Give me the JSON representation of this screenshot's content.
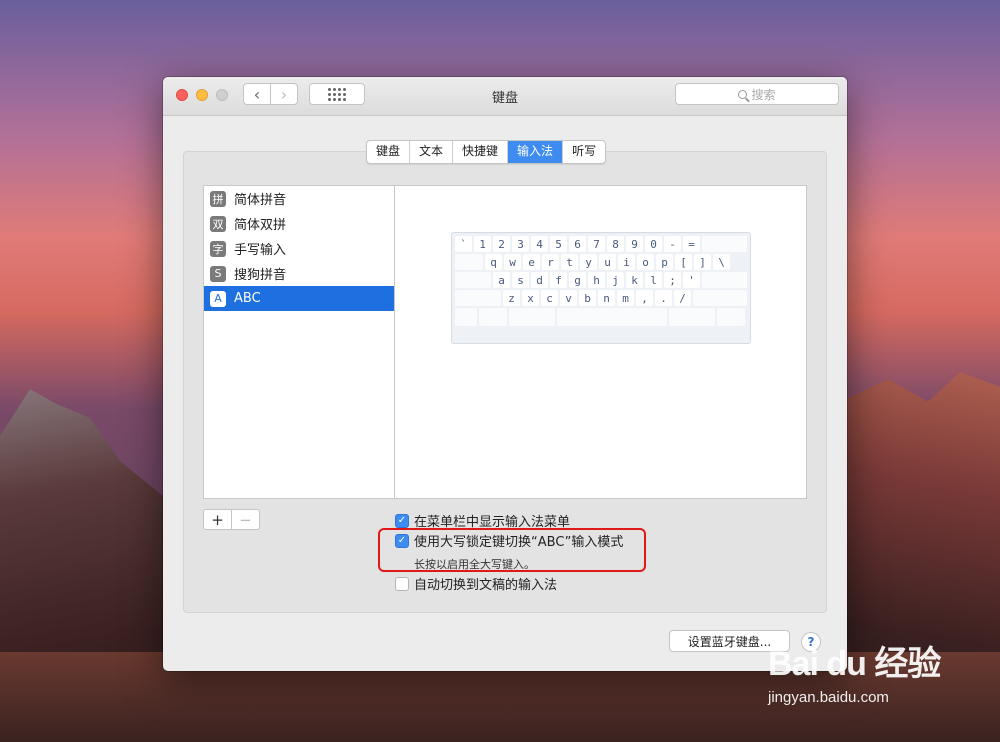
{
  "window": {
    "title": "键盘",
    "search_placeholder": "搜索"
  },
  "tabs": [
    {
      "label": "键盘",
      "active": false
    },
    {
      "label": "文本",
      "active": false
    },
    {
      "label": "快捷键",
      "active": false
    },
    {
      "label": "输入法",
      "active": true
    },
    {
      "label": "听写",
      "active": false
    }
  ],
  "input_sources": [
    {
      "icon_char": "拼",
      "icon": "pinyin-icon",
      "label": "简体拼音"
    },
    {
      "icon_char": "双",
      "icon": "shuangpin-icon",
      "label": "简体双拼"
    },
    {
      "icon_char": "字",
      "icon": "handwriting-icon",
      "label": "手写输入"
    },
    {
      "icon_char": "S",
      "icon": "sogou-icon",
      "label": "搜狗拼音"
    },
    {
      "icon_char": "A",
      "icon": "abc-icon",
      "label": "ABC",
      "selected": true
    }
  ],
  "keyboard_rows": [
    [
      "`",
      "1",
      "2",
      "3",
      "4",
      "5",
      "6",
      "7",
      "8",
      "9",
      "0",
      "-",
      "="
    ],
    [
      "q",
      "w",
      "e",
      "r",
      "t",
      "y",
      "u",
      "i",
      "o",
      "p",
      "[",
      "]",
      "\\"
    ],
    [
      "a",
      "s",
      "d",
      "f",
      "g",
      "h",
      "j",
      "k",
      "l",
      ";",
      "'"
    ],
    [
      "z",
      "x",
      "c",
      "v",
      "b",
      "n",
      "m",
      ",",
      ".",
      "/"
    ]
  ],
  "list_controls": {
    "add": "+",
    "remove": "−"
  },
  "options": {
    "show_menu": {
      "label": "在菜单栏中显示输入法菜单",
      "checked": true
    },
    "caps_lock": {
      "label": "使用大写锁定键切换“ABC”输入模式",
      "checked": true,
      "hint": "长按以启用全大写键入。"
    },
    "auto_switch": {
      "label": "自动切换到文稿的输入法",
      "checked": false
    }
  },
  "footer": {
    "bluetooth_button": "设置蓝牙键盘...",
    "help": "?"
  },
  "watermark": {
    "logo": "Bai du 经验",
    "url": "jingyan.baidu.com"
  },
  "colors": {
    "accent": "#3f8cf0",
    "selection": "#1e6fe0",
    "highlight": "#e01818"
  }
}
